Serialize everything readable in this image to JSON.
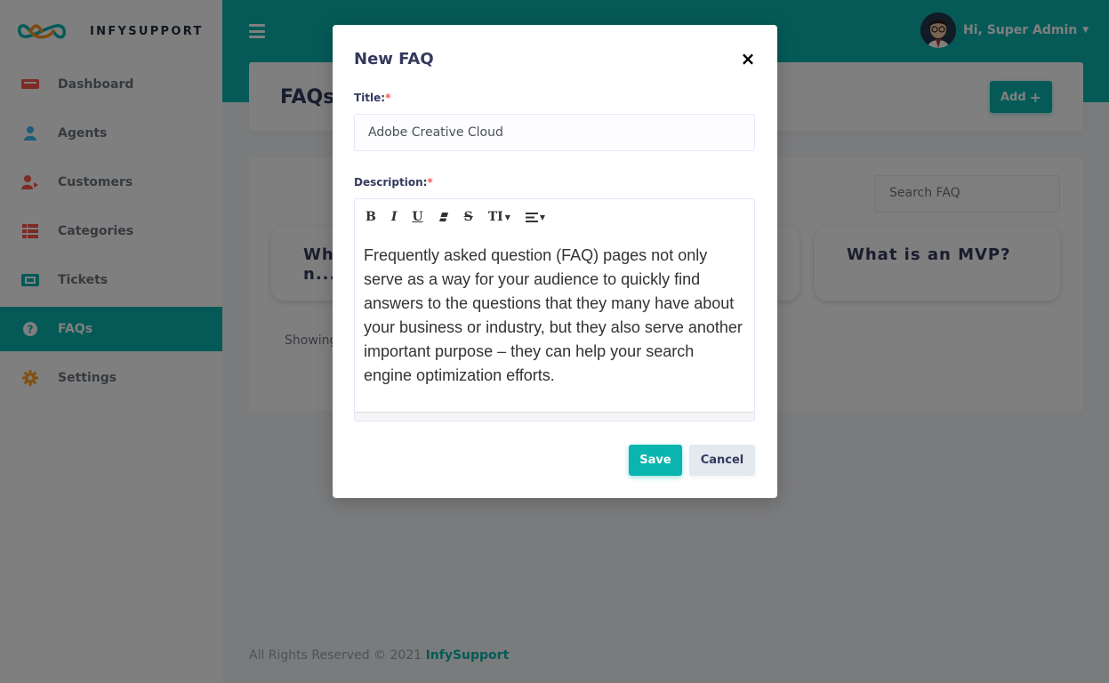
{
  "brand": {
    "name": "INFYSUPPORT"
  },
  "sidebar": {
    "items": [
      {
        "label": "Dashboard",
        "icon": "dashboard-icon",
        "color": "#fc544b"
      },
      {
        "label": "Agents",
        "icon": "user-icon",
        "color": "#3abaf4"
      },
      {
        "label": "Customers",
        "icon": "user-arrow-icon",
        "color": "#fc544b"
      },
      {
        "label": "Categories",
        "icon": "grid-icon",
        "color": "#fc544b"
      },
      {
        "label": "Tickets",
        "icon": "ticket-icon",
        "color": "#0bb5af"
      },
      {
        "label": "FAQs",
        "icon": "question-circle-icon",
        "active": true
      },
      {
        "label": "Settings",
        "icon": "gear-icon",
        "color": "#ffa426"
      }
    ]
  },
  "header": {
    "user_greeting": "Hi, Super Admin"
  },
  "page": {
    "title": "FAQs",
    "add_label": "Add",
    "search_placeholder": "Search FAQ",
    "faq_cards": [
      "Wh",
      "n...",
      "What is an MVP?"
    ],
    "showing_text": "Showing"
  },
  "footer": {
    "text": "All Rights Reserved © 2021",
    "link": "InfySupport"
  },
  "modal": {
    "title": "New FAQ",
    "close_label": "×",
    "title_label": "Title:",
    "required_mark": "*",
    "title_value": "Adobe Creative Cloud",
    "description_label": "Description:",
    "toolbar": {
      "bold": "B",
      "italic": "I",
      "underline": "U",
      "strikethrough": "S",
      "font_size": "TI"
    },
    "description_value": "Frequently asked question (FAQ) pages not only serve as a way for your audience to quickly find answers to the questions that they many have about your business or industry, but they also serve another important purpose – they can help your search engine optimization efforts.",
    "save_label": "Save",
    "cancel_label": "Cancel"
  },
  "colors": {
    "accent": "#0bb5af",
    "required": "#fc544b"
  }
}
